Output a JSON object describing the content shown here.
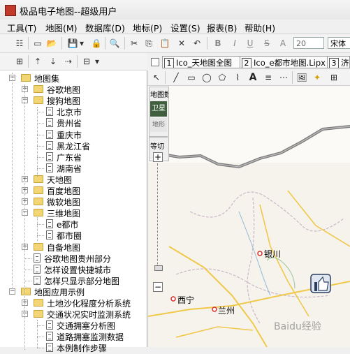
{
  "window": {
    "title": "极品电子地图--超级用户"
  },
  "menubar": {
    "items": [
      "工具(T)",
      "地图(M)",
      "数据库(D)",
      "地标(P)",
      "设置(S)",
      "报表(B)",
      "帮助(H)"
    ]
  },
  "toolbar": {
    "font_size": "20",
    "font_name": "宋体"
  },
  "tabs": [
    {
      "num": "1",
      "label": "Ico_天地图全图"
    },
    {
      "num": "2",
      "label": "Ico_e都市地图.Lipx"
    },
    {
      "num": "3",
      "label": "济"
    }
  ],
  "map": {
    "panel_labels": {
      "title": "地图数",
      "sat": "卫星",
      "terrain": "地形",
      "layer": "等切"
    },
    "cities": [
      "银川",
      "西宁",
      "兰州"
    ],
    "watermark": "Baidu经验"
  },
  "tree": [
    {
      "label": "地图集",
      "type": "folder",
      "expanded": true
    },
    {
      "label": "谷歌地图",
      "type": "folder",
      "expanded": false
    },
    {
      "label": "搜狗地图",
      "type": "folder",
      "expanded": true
    },
    {
      "label": "北京市",
      "type": "doc"
    },
    {
      "label": "贵州省",
      "type": "doc"
    },
    {
      "label": "重庆市",
      "type": "doc"
    },
    {
      "label": "黑龙江省",
      "type": "doc"
    },
    {
      "label": "广东省",
      "type": "doc"
    },
    {
      "label": "湖南省",
      "type": "doc"
    },
    {
      "label": "天地图",
      "type": "folder",
      "expanded": false
    },
    {
      "label": "百度地图",
      "type": "folder",
      "expanded": false
    },
    {
      "label": "微软地图",
      "type": "folder",
      "expanded": false
    },
    {
      "label": "三维地图",
      "type": "folder",
      "expanded": true
    },
    {
      "label": "e都市",
      "type": "doc"
    },
    {
      "label": "都市圈",
      "type": "doc"
    },
    {
      "label": "自备地图",
      "type": "folder",
      "expanded": false
    },
    {
      "label": "谷歌地图贵州部分",
      "type": "doc"
    },
    {
      "label": "怎样设置快捷城市",
      "type": "doc"
    },
    {
      "label": "怎样只显示部分地图",
      "type": "doc"
    },
    {
      "label": "地图应用示例",
      "type": "folder",
      "expanded": true
    },
    {
      "label": "土地沙化程度分析系统",
      "type": "folder",
      "expanded": false
    },
    {
      "label": "交通状况实时监测系统",
      "type": "folder",
      "expanded": true
    },
    {
      "label": "交通拥塞分析图",
      "type": "doc"
    },
    {
      "label": "道路拥塞监测数据",
      "type": "doc"
    },
    {
      "label": "本例制作步骤",
      "type": "doc"
    }
  ]
}
